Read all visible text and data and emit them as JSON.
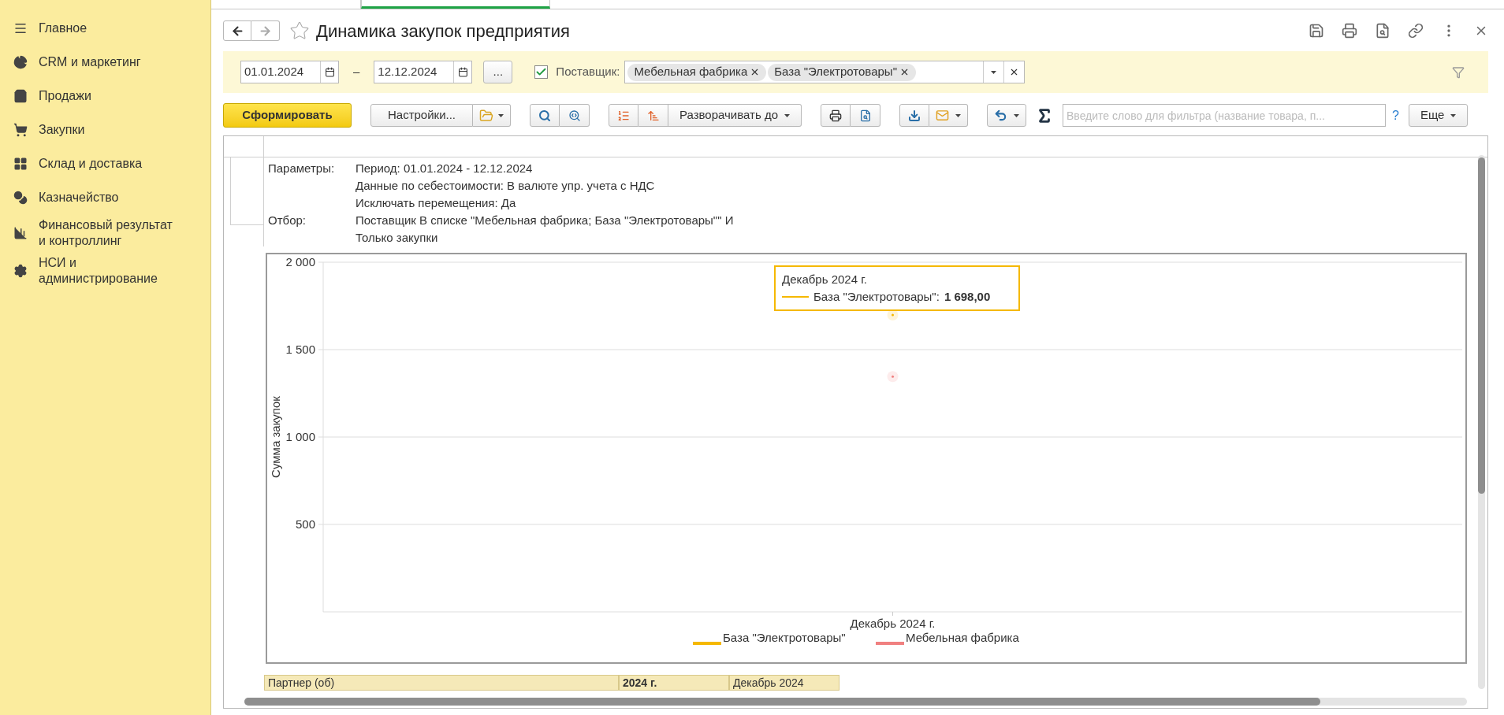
{
  "sidebar": {
    "items": [
      {
        "label": "Главное"
      },
      {
        "label": "CRM и маркетинг"
      },
      {
        "label": "Продажи"
      },
      {
        "label": "Закупки"
      },
      {
        "label": "Склад и доставка"
      },
      {
        "label": "Казначейство"
      },
      {
        "label": "Финансовый результат и контроллинг"
      },
      {
        "label": "НСИ и администрирование"
      }
    ]
  },
  "window": {
    "title": "Динамика закупок предприятия"
  },
  "filters": {
    "date_from": "01.01.2024",
    "dash": "–",
    "date_to": "12.12.2024",
    "more_button": "...",
    "supplier": {
      "checked": true,
      "label": "Поставщик:",
      "tags": [
        "Мебельная фабрика",
        "База \"Электротовары\""
      ]
    }
  },
  "toolbar": {
    "generate": "Сформировать",
    "settings": "Настройки...",
    "expand": "Разворачивать до",
    "search_placeholder": "Введите слово для фильтра (название товара, п...",
    "help": "?",
    "more": "Еще"
  },
  "report": {
    "params": [
      {
        "label": "Параметры:",
        "lines": [
          "Период: 01.01.2024 - 12.12.2024",
          "Данные по себестоимости: В валюте упр. учета с НДС",
          "Исключать перемещения: Да"
        ]
      },
      {
        "label": "Отбор:",
        "lines": [
          "Поставщик В списке \"Мебельная фабрика; База \"Электротовары\"\" И",
          "Только закупки"
        ]
      }
    ],
    "chart_data": {
      "type": "line",
      "grid": true,
      "legend": true,
      "ylabel": "Сумма закупок",
      "categories": [
        "Декабрь 2024 г."
      ],
      "ylim": [
        0,
        2000
      ],
      "yticks": [
        {
          "value": 500,
          "label": "500"
        },
        {
          "value": 1000,
          "label": "1 000"
        },
        {
          "value": 1500,
          "label": "1 500"
        },
        {
          "value": 2000,
          "label": "2 000"
        }
      ],
      "series": [
        {
          "name": "База \"Электротовары\"",
          "color": "#f5b800",
          "marker": "circle",
          "values": [
            1698
          ]
        },
        {
          "name": "Мебельная фабрика",
          "color": "#f08080",
          "marker": "circle",
          "values": [
            1346
          ]
        }
      ]
    },
    "tooltip": {
      "title": "Декабрь 2024 г.",
      "series": "База \"Электротовары\":",
      "value": "1 698,00"
    },
    "table_header": [
      "Партнер (об)",
      "2024 г.",
      "Декабрь 2024"
    ]
  }
}
